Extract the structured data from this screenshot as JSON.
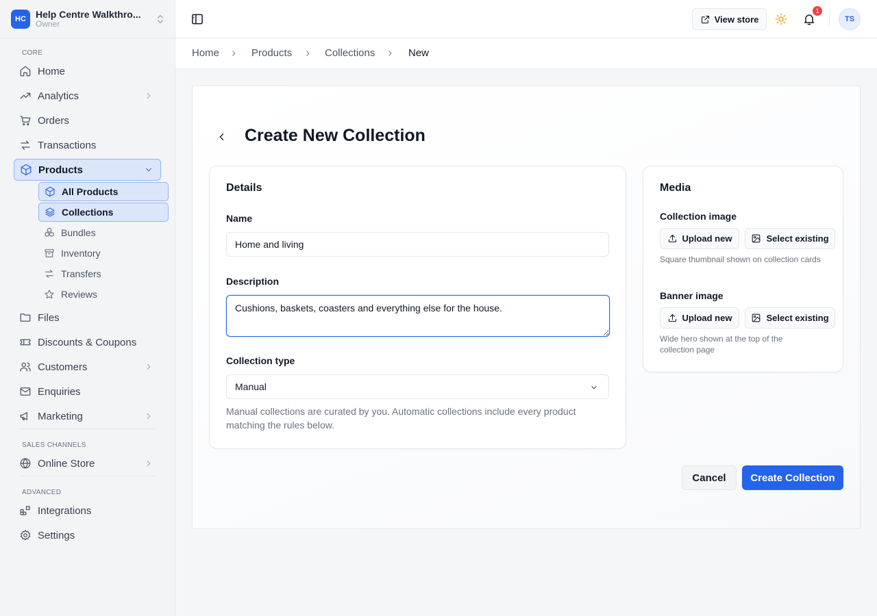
{
  "workspace": {
    "initials": "HC",
    "name": "Help Centre Walkthro...",
    "role": "Owner"
  },
  "sidebar": {
    "sections": [
      {
        "label": "CORE"
      },
      {
        "label": "SALES CHANNELS"
      },
      {
        "label": "ADVANCED"
      }
    ],
    "items": [
      {
        "label": "Home",
        "icon": "home-icon"
      },
      {
        "label": "Analytics",
        "icon": "trend-icon"
      },
      {
        "label": "Orders",
        "icon": "cart-icon"
      },
      {
        "label": "Transactions",
        "icon": "arrows-icon"
      },
      {
        "label": "Products",
        "icon": "box-icon",
        "active": true
      },
      {
        "label": "Files",
        "icon": "folder-icon"
      },
      {
        "label": "Discounts & Coupons",
        "icon": "ticket-icon"
      },
      {
        "label": "Customers",
        "icon": "users-icon"
      },
      {
        "label": "Enquiries",
        "icon": "mail-icon"
      },
      {
        "label": "Marketing",
        "icon": "megaphone-icon"
      },
      {
        "label": "Online Store",
        "icon": "globe-icon"
      },
      {
        "label": "Integrations",
        "icon": "blocks-icon"
      },
      {
        "label": "Settings",
        "icon": "gear-icon"
      }
    ],
    "sub_items": [
      {
        "label": "All Products",
        "icon": "box-icon"
      },
      {
        "label": "Collections",
        "icon": "layers-icon",
        "active": true
      },
      {
        "label": "Bundles",
        "icon": "bundle-icon"
      },
      {
        "label": "Inventory",
        "icon": "archive-icon"
      },
      {
        "label": "Transfers",
        "icon": "arrows-icon"
      },
      {
        "label": "Reviews",
        "icon": "star-icon"
      }
    ]
  },
  "topbar": {
    "view_store_label": "View store",
    "notification_count": "1",
    "avatar_initials": "TS"
  },
  "breadcrumb": [
    "Home",
    "Products",
    "Collections",
    "New"
  ],
  "page": {
    "title": "Create New Collection"
  },
  "details": {
    "title": "Details",
    "name_label": "Name",
    "name_value": "Home and living",
    "description_label": "Description",
    "description_value": "Cushions, baskets, coasters and everything else for the house.",
    "type_label": "Collection type",
    "type_value": "Manual",
    "type_help": "Manual collections are curated by you. Automatic collections include every product matching the rules below."
  },
  "media": {
    "title": "Media",
    "collection_image_label": "Collection image",
    "collection_image_help": "Square thumbnail shown on collection cards",
    "banner_image_label": "Banner image",
    "banner_image_help": "Wide hero shown at the top of the collection page",
    "upload_label": "Upload new",
    "select_label": "Select existing"
  },
  "actions": {
    "cancel_label": "Cancel",
    "create_label": "Create Collection"
  },
  "colors": {
    "accent": "#2563eb",
    "badge": "#ef4444",
    "sun": "#f59e0b"
  }
}
